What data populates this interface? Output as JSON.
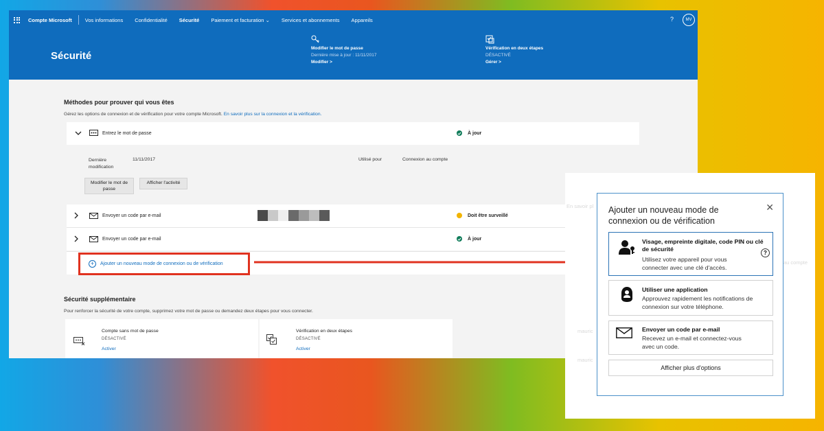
{
  "topbar": {
    "brand": "Compte Microsoft",
    "nav": [
      "Vos informations",
      "Confidentialité",
      "Sécurité",
      "Paiement et facturation",
      "Services et abonnements",
      "Appareils"
    ],
    "help": "?",
    "avatar": "MV"
  },
  "banner": {
    "title": "Sécurité",
    "password": {
      "heading": "Modifier le mot de passe",
      "sub": "Dernière mise à jour : 11/11/2017",
      "link": "Modifier >"
    },
    "twostep": {
      "heading": "Vérification en deux étapes",
      "sub": "DÉSACTIVÉ",
      "link": "Gérer >"
    }
  },
  "methods": {
    "title": "Méthodes pour prouver qui vous êtes",
    "desc": "Gérez les options de connexion et de vérification pour votre compte Microsoft.",
    "desc_link": "En savoir plus sur la connexion et la vérification.",
    "rows": [
      {
        "label": "Entrez le mot de passe",
        "status": "À jour",
        "status_color": "#107c5a"
      },
      {
        "label": "Envoyer un code par e-mail",
        "status": "Doit être surveillé",
        "status_color": "#f2b400"
      },
      {
        "label": "Envoyer un code par e-mail",
        "status": "À jour",
        "status_color": "#107c5a"
      }
    ],
    "details": {
      "last_mod_label": "Dernière modification",
      "last_mod_value": "11/11/2017",
      "used_for_label": "Utilisé pour",
      "used_for_value": "Connexion au compte",
      "btn_change": "Modifier le mot de passe",
      "btn_activity": "Afficher l'activité"
    },
    "add_label": "Ajouter un nouveau mode de connexion ou de vérification"
  },
  "extra": {
    "title": "Sécurité supplémentaire",
    "desc": "Pour renforcer la sécurité de votre compte, supprimez votre mot de passe ou demandez deux étapes pour vous connecter.",
    "cards": [
      {
        "title": "Compte sans mot de passe",
        "state": "DÉSACTIVÉ",
        "action": "Activer"
      },
      {
        "title": "Vérification en deux étapes",
        "state": "DÉSACTIVÉ",
        "action": "Activer"
      }
    ]
  },
  "dialog": {
    "title": "Ajouter un nouveau mode de connexion ou de vérification",
    "options": [
      {
        "heading": "Visage, empreinte digitale, code PIN ou clé de sécurité",
        "desc": "Utilisez votre appareil pour vous connecter avec une clé d'accès.",
        "icon": "user-key-icon"
      },
      {
        "heading": "Utiliser une application",
        "desc": "Approuvez rapidement les notifications de connexion sur votre téléphone.",
        "icon": "authenticator-icon"
      },
      {
        "heading": "Envoyer un code par e-mail",
        "desc": "Recevez un e-mail et connectez-vous avec un code.",
        "icon": "mail-icon"
      }
    ],
    "more": "Afficher plus d'options",
    "help_mark": "?"
  },
  "ghost_text": [
    "En savoir pl",
    "au compte",
    "mauric",
    "mauric"
  ],
  "colors": {
    "brand_blue": "#0f6cbd",
    "ok_green": "#107c5a",
    "warn_yellow": "#f2b400",
    "highlight_red": "#e0321f"
  }
}
